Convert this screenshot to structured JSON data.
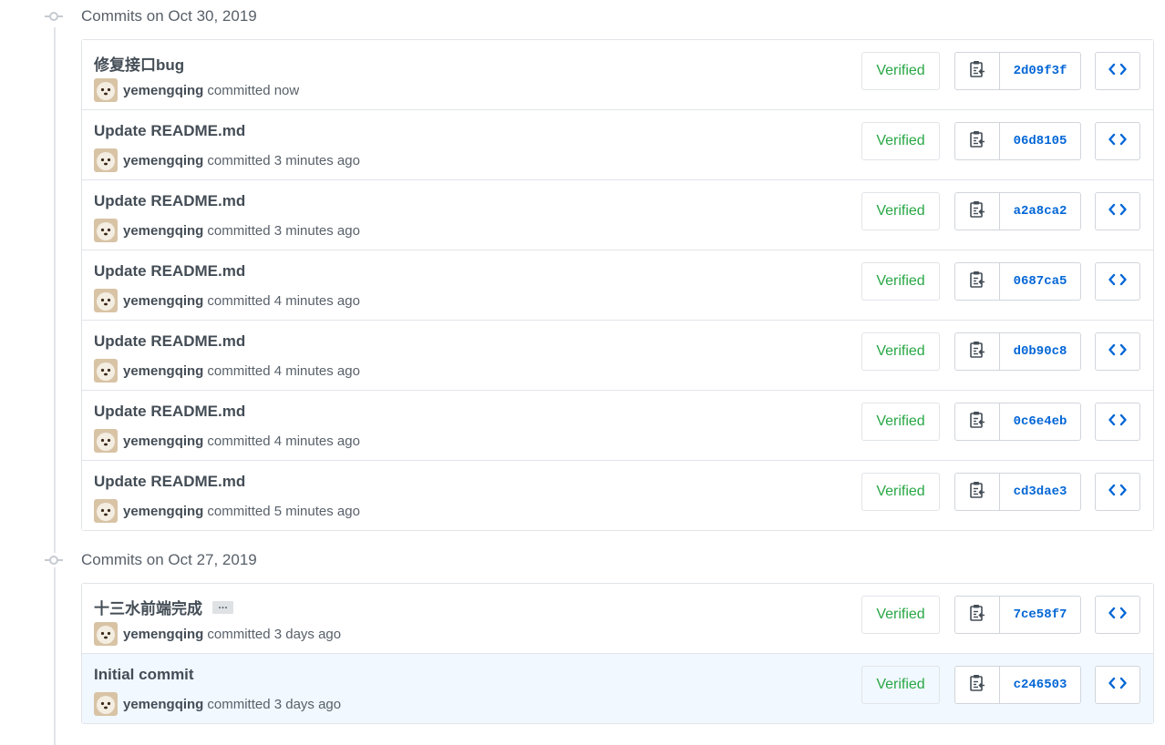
{
  "groups": [
    {
      "title": "Commits on Oct 30, 2019",
      "commits": [
        {
          "message": "修复接口bug",
          "author": "yemengqing",
          "action": "committed",
          "time": "now",
          "verified": "Verified",
          "sha": "2d09f3f"
        },
        {
          "message": "Update README.md",
          "author": "yemengqing",
          "action": "committed",
          "time": "3 minutes ago",
          "verified": "Verified",
          "sha": "06d8105"
        },
        {
          "message": "Update README.md",
          "author": "yemengqing",
          "action": "committed",
          "time": "3 minutes ago",
          "verified": "Verified",
          "sha": "a2a8ca2"
        },
        {
          "message": "Update README.md",
          "author": "yemengqing",
          "action": "committed",
          "time": "4 minutes ago",
          "verified": "Verified",
          "sha": "0687ca5"
        },
        {
          "message": "Update README.md",
          "author": "yemengqing",
          "action": "committed",
          "time": "4 minutes ago",
          "verified": "Verified",
          "sha": "d0b90c8"
        },
        {
          "message": "Update README.md",
          "author": "yemengqing",
          "action": "committed",
          "time": "4 minutes ago",
          "verified": "Verified",
          "sha": "0c6e4eb"
        },
        {
          "message": "Update README.md",
          "author": "yemengqing",
          "action": "committed",
          "time": "5 minutes ago",
          "verified": "Verified",
          "sha": "cd3dae3"
        }
      ]
    },
    {
      "title": "Commits on Oct 27, 2019",
      "commits": [
        {
          "message": "十三水前端完成",
          "author": "yemengqing",
          "action": "committed",
          "time": "3 days ago",
          "verified": "Verified",
          "sha": "7ce58f7",
          "ellipsis": "…"
        },
        {
          "message": "Initial commit",
          "author": "yemengqing",
          "action": "committed",
          "time": "3 days ago",
          "verified": "Verified",
          "sha": "c246503"
        }
      ]
    }
  ],
  "icons": {
    "timeline": "git-commit-icon",
    "avatar": "user-avatar",
    "copy": "clipboard-copy-icon",
    "browse": "code-brackets-icon"
  },
  "colors": {
    "verified_text": "#28a745",
    "sha_link": "#0366d6",
    "highlight_row": "#f1f8ff",
    "border": "#e1e4e8"
  }
}
